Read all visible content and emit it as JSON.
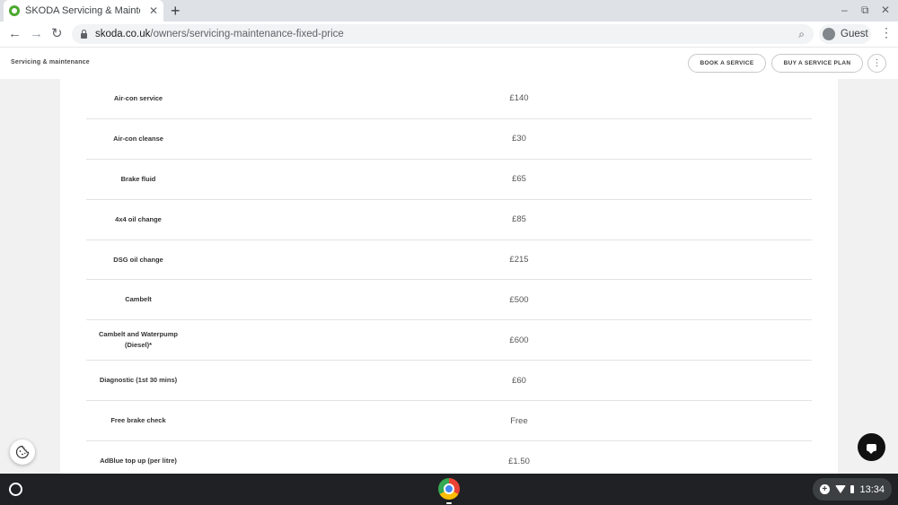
{
  "browser": {
    "tab_title": "ŠKODA Servicing & Maintenance",
    "tab_close": "✕",
    "new_tab": "+",
    "url_host": "skoda.co.uk",
    "url_path": "/owners/servicing-maintenance-fixed-price",
    "profile_label": "Guest",
    "window_controls": [
      "–",
      "⧉",
      "✕"
    ]
  },
  "site": {
    "title": "Servicing & maintenance",
    "book_label": "BOOK A SERVICE",
    "plan_label": "BUY A SERVICE PLAN"
  },
  "prices": [
    {
      "service": "Air-con service",
      "price": "£140"
    },
    {
      "service": "Air-con cleanse",
      "price": "£30"
    },
    {
      "service": "Brake fluid",
      "price": "£65"
    },
    {
      "service": "4x4 oil change",
      "price": "£85"
    },
    {
      "service": "DSG oil change",
      "price": "£215"
    },
    {
      "service": "Cambelt",
      "price": "£500"
    },
    {
      "service": "Cambelt and Waterpump (Diesel)*",
      "price": "£600"
    },
    {
      "service": "Diagnostic (1st 30 mins)",
      "price": "£60"
    },
    {
      "service": "Free brake check",
      "price": "Free"
    },
    {
      "service": "AdBlue top up (per litre)",
      "price": "£1.50"
    }
  ],
  "shelf": {
    "time": "13:34"
  },
  "colors": {
    "skoda_green": "#4ba82e",
    "shelf_bg": "#202124",
    "chat_button": "#111111"
  },
  "icons": {
    "cookie": "cookie-icon",
    "chat": "chat-icon"
  }
}
